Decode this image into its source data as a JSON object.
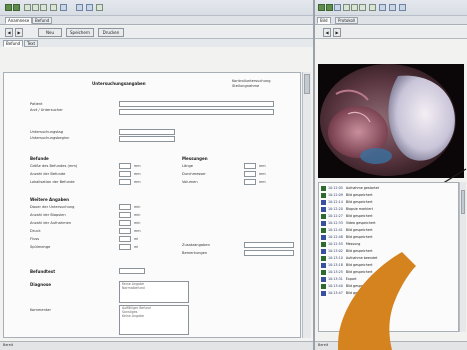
{
  "main_window": {
    "tabs": [
      "Anamnese",
      "Befund"
    ],
    "toolbar_buttons": [
      "Zurück",
      "Vor",
      "Neu",
      "Speichern",
      "Löschen",
      "Drucken",
      "Kopieren",
      "Einfügen",
      "Suchen",
      "Optionen"
    ],
    "action_buttons": [
      "Neu",
      "Speichern",
      "Drucken"
    ],
    "subtabs": [
      "Befund",
      "Text"
    ]
  },
  "form": {
    "title": "Untersuchungsangaben",
    "right_title": "Kontrolluntersuchung",
    "name_label": "Patient",
    "name_label2": "Arzt / Untersucher",
    "date_label": "Untersuchungstag",
    "date_label2": "Untersuchungsbeginn",
    "section_a": "Befunde",
    "a_rows": [
      {
        "label": "Größe des Befundes (mm)",
        "unit": "mm"
      },
      {
        "label": "Anzahl der Befunde",
        "unit": "mm"
      },
      {
        "label": "Lokalisation der Befunde",
        "unit": "mm"
      }
    ],
    "section_b": "Messungen",
    "b_rows": [
      {
        "label": "Länge",
        "unit": "mm"
      },
      {
        "label": "Durchmesser",
        "unit": "mm"
      },
      {
        "label": "Volumen",
        "unit": "mm"
      }
    ],
    "section_c": "Weitere Angaben",
    "c_rows": [
      {
        "label": "Dauer der Untersuchung",
        "unit": "min"
      },
      {
        "label": "Anzahl der Biopsien",
        "unit": "min"
      },
      {
        "label": "Anzahl der Aufnahmen",
        "unit": "min"
      },
      {
        "label": "Druck",
        "unit": "mm"
      },
      {
        "label": "Fluss",
        "unit": "ml"
      },
      {
        "label": "Spülmenge",
        "unit": "ml"
      }
    ],
    "c_right": [
      "Zusatzangaben",
      "Bemerkungen"
    ],
    "field_label": "Befundtext",
    "field_value": "",
    "section_d": "Diagnose",
    "d_list": [
      "Keine Angabe",
      "Normalbefund",
      "Auffälliger Befund",
      "Sonstiges"
    ],
    "comment_label": "Kommentar",
    "status": "Bereit"
  },
  "side_window": {
    "toolbar_buttons": [
      "Start",
      "Stop",
      "Aufnahme",
      "Bild",
      "Video",
      "Zoom",
      "Licht",
      "Fokus",
      "Archiv",
      "Export"
    ],
    "tabs": [
      "Bild",
      "Protokoll"
    ],
    "log_rows": [
      {
        "time": "10:12:05",
        "text": "Aufnahme gestartet",
        "color": "#2d6a2d"
      },
      {
        "time": "10:12:09",
        "text": "Bild gespeichert",
        "color": "#2d6a2d"
      },
      {
        "time": "10:12:14",
        "text": "Bild gespeichert",
        "color": "#3a4fa0"
      },
      {
        "time": "10:12:20",
        "text": "Biopsie markiert",
        "color": "#3a4fa0"
      },
      {
        "time": "10:12:27",
        "text": "Bild gespeichert",
        "color": "#2d6a2d"
      },
      {
        "time": "10:12:33",
        "text": "Video gespeichert",
        "color": "#3a4fa0"
      },
      {
        "time": "10:12:41",
        "text": "Bild gespeichert",
        "color": "#2d6a2d"
      },
      {
        "time": "10:12:48",
        "text": "Bild gespeichert",
        "color": "#3a4fa0"
      },
      {
        "time": "10:12:55",
        "text": "Messung",
        "color": "#2d6a2d"
      },
      {
        "time": "10:13:02",
        "text": "Bild gespeichert",
        "color": "#3a4fa0"
      },
      {
        "time": "10:13:10",
        "text": "Aufnahme beendet",
        "color": "#2d6a2d"
      },
      {
        "time": "10:13:18",
        "text": "Bild gespeichert",
        "color": "#3a4fa0"
      },
      {
        "time": "10:13:25",
        "text": "Bild gespeichert",
        "color": "#2d6a2d"
      },
      {
        "time": "10:13:31",
        "text": "Export",
        "color": "#3a4fa0"
      },
      {
        "time": "10:13:40",
        "text": "Bild gespeichert",
        "color": "#2d6a2d"
      },
      {
        "time": "10:13:47",
        "text": "Bild gespeichert",
        "color": "#3a4fa0"
      }
    ],
    "status": "Bereit"
  },
  "colors": {
    "accent_orange": "#d4831f"
  }
}
